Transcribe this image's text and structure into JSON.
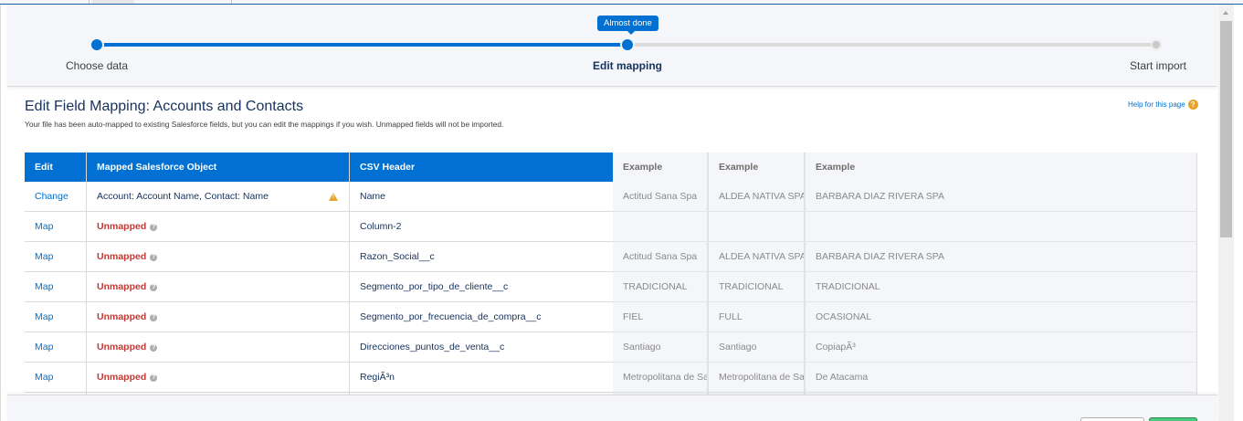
{
  "progress": {
    "tooltip": "Almost done",
    "steps": [
      {
        "label": "Choose data",
        "state": "done"
      },
      {
        "label": "Edit mapping",
        "state": "current"
      },
      {
        "label": "Start import",
        "state": "todo"
      }
    ],
    "completed_fraction": 0.5
  },
  "header": {
    "title": "Edit Field Mapping: Accounts and Contacts",
    "subtitle": "Your file has been auto-mapped to existing Salesforce fields, but you can edit the mappings if you wish. Unmapped fields will not be imported.",
    "help_link": "Help for this page"
  },
  "table": {
    "columns": {
      "edit": "Edit",
      "object": "Mapped Salesforce Object",
      "csv": "CSV Header",
      "example1": "Example",
      "example2": "Example",
      "example3": "Example"
    },
    "rows": [
      {
        "action": "Change",
        "object": "Account: Account Name, Contact: Name",
        "warning": true,
        "csv": "Name",
        "ex1": "Actitud Sana Spa",
        "ex2": "ALDEA NATIVA SPA",
        "ex3": "BARBARA DIAZ RIVERA SPA"
      },
      {
        "action": "Map",
        "object": "Unmapped",
        "csv": "Column-2",
        "ex1": "",
        "ex2": "",
        "ex3": ""
      },
      {
        "action": "Map",
        "object": "Unmapped",
        "csv": "Razon_Social__c",
        "ex1": "Actitud Sana Spa",
        "ex2": "ALDEA NATIVA SPA",
        "ex3": "BARBARA DIAZ RIVERA SPA"
      },
      {
        "action": "Map",
        "object": "Unmapped",
        "csv": "Segmento_por_tipo_de_cliente__c",
        "ex1": "TRADICIONAL",
        "ex2": "TRADICIONAL",
        "ex3": "TRADICIONAL"
      },
      {
        "action": "Map",
        "object": "Unmapped",
        "csv": "Segmento_por_frecuencia_de_compra__c",
        "ex1": "FIEL",
        "ex2": "FULL",
        "ex3": "OCASIONAL"
      },
      {
        "action": "Map",
        "object": "Unmapped",
        "csv": "Direcciones_puntos_de_venta__c",
        "ex1": "Santiago",
        "ex2": "Santiago",
        "ex3": "CopiapÃ³"
      },
      {
        "action": "Map",
        "object": "Unmapped",
        "csv": "RegiÃ³n",
        "ex1": "Metropolitana de Santiago",
        "ex2": "Metropolitana de Santiago",
        "ex3": "De Atacama"
      }
    ]
  },
  "icons": {
    "info": "info-circle-icon",
    "warning": "warning-triangle-icon",
    "help": "question-circle-icon"
  },
  "colors": {
    "accent": "#0070d2",
    "unmapped": "#c23934",
    "warning": "#e8a32b",
    "next_button": "#4bca81"
  }
}
